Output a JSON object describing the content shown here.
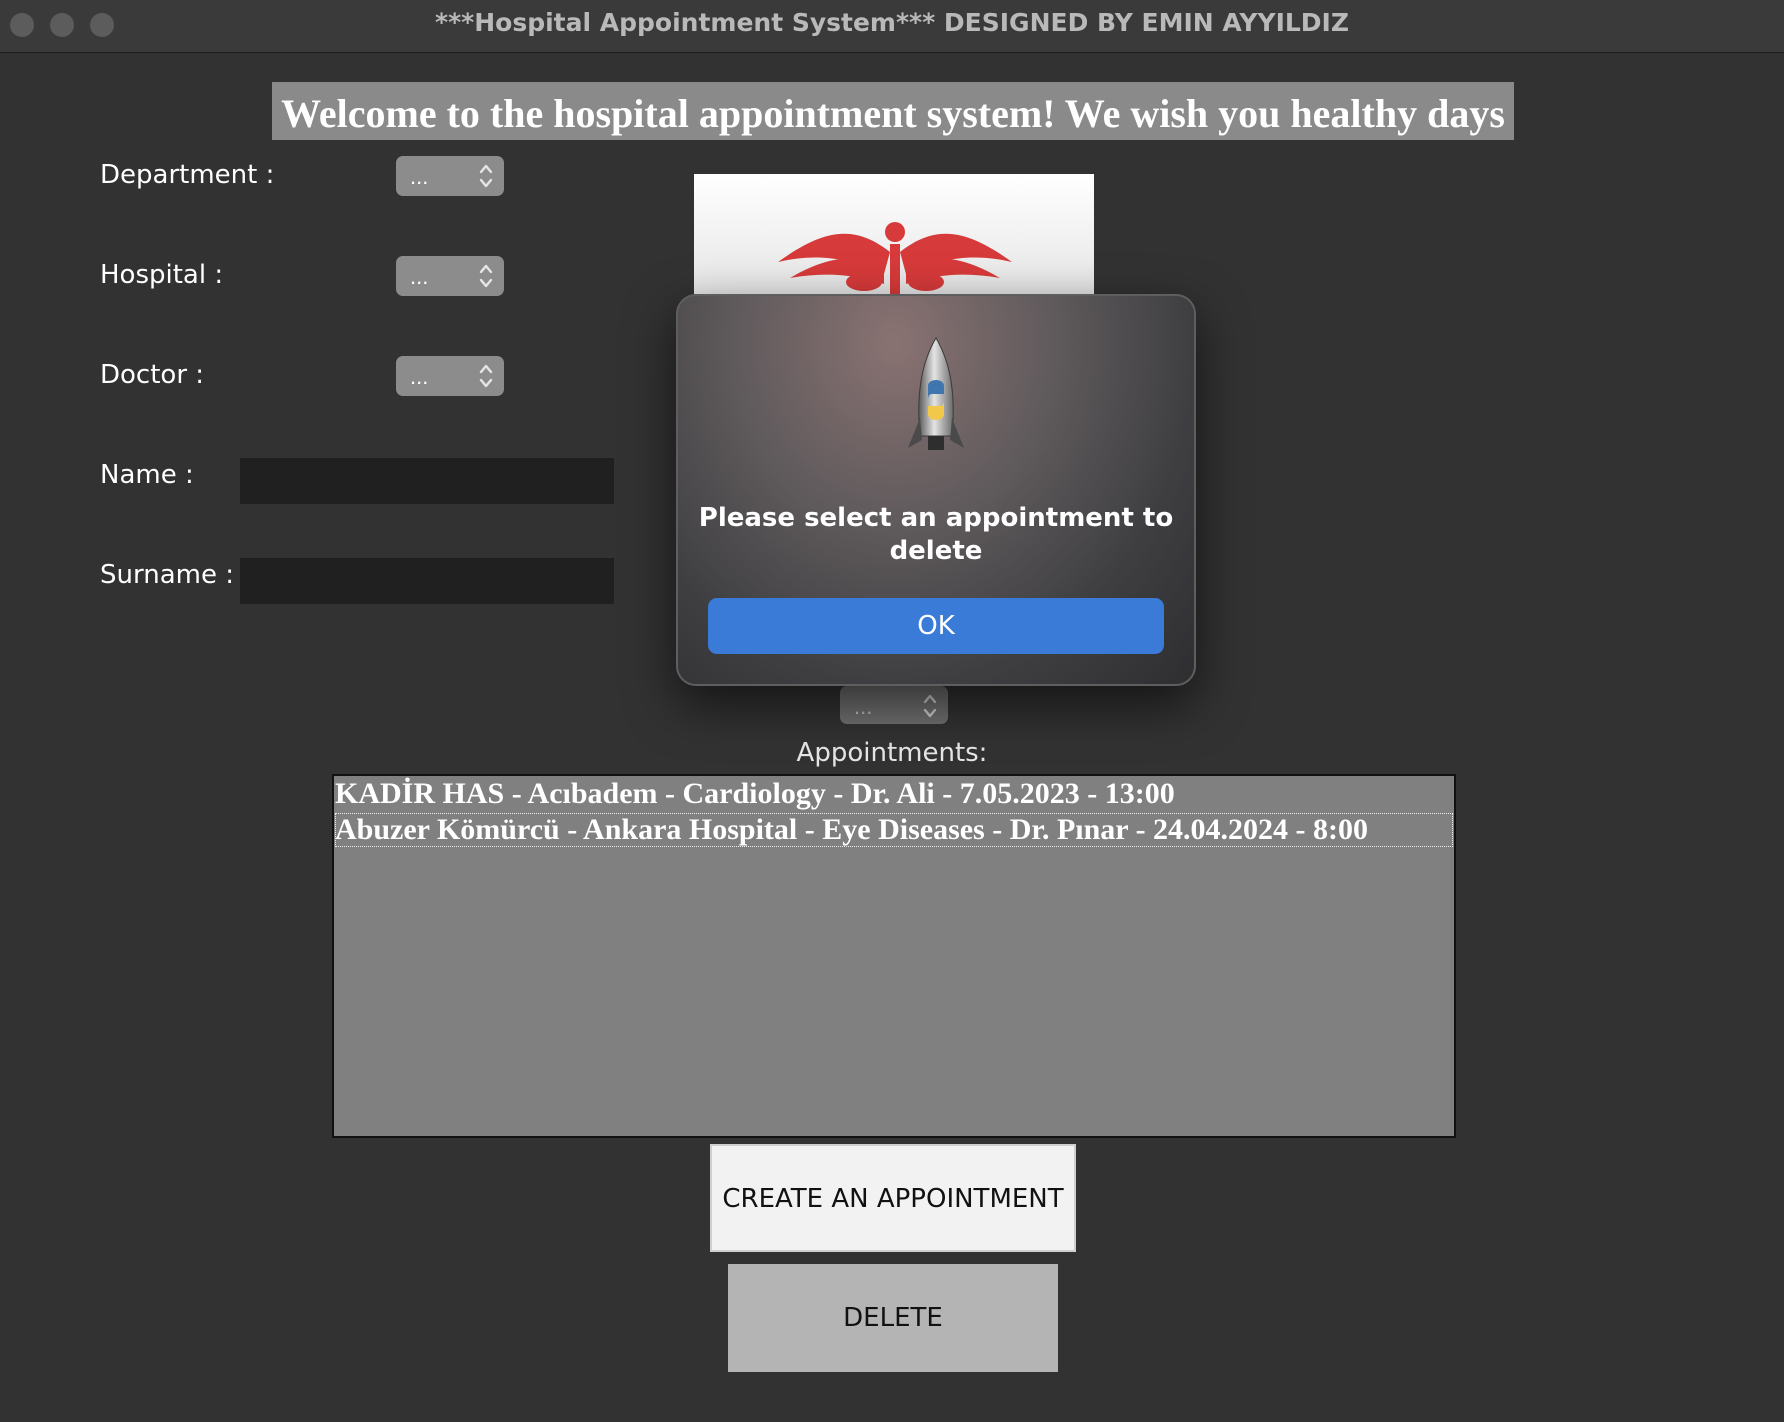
{
  "window": {
    "title": "***Hospital Appointment System*** DESIGNED BY EMIN AYYILDIZ"
  },
  "welcome_text": "Welcome to the hospital appointment system! We wish you healthy days",
  "form": {
    "department_label": "Department :",
    "department_value": "...",
    "hospital_label": "Hospital :",
    "hospital_value": "...",
    "doctor_label": "Doctor :",
    "doctor_value": "...",
    "name_label": "Name :",
    "name_value": "",
    "surname_label": "Surname :",
    "surname_value": "",
    "time_value": "..."
  },
  "appointments": {
    "label": "Appointments:",
    "items": [
      "KADİR HAS - Acıbadem - Cardiology - Dr. Ali - 7.05.2023 - 13:00",
      "Abuzer Kömürcü - Ankara Hospital - Eye Diseases - Dr. Pınar - 24.04.2024 - 8:00"
    ]
  },
  "buttons": {
    "create_label": "CREATE AN APPOINTMENT",
    "delete_label": "DELETE"
  },
  "dialog": {
    "message": "Please select an appointment to delete",
    "ok_label": "OK",
    "icon": "python-launcher-rocket-icon"
  },
  "colors": {
    "background": "#323232",
    "ok_button": "#3a7bd8",
    "listbox": "#808080"
  }
}
